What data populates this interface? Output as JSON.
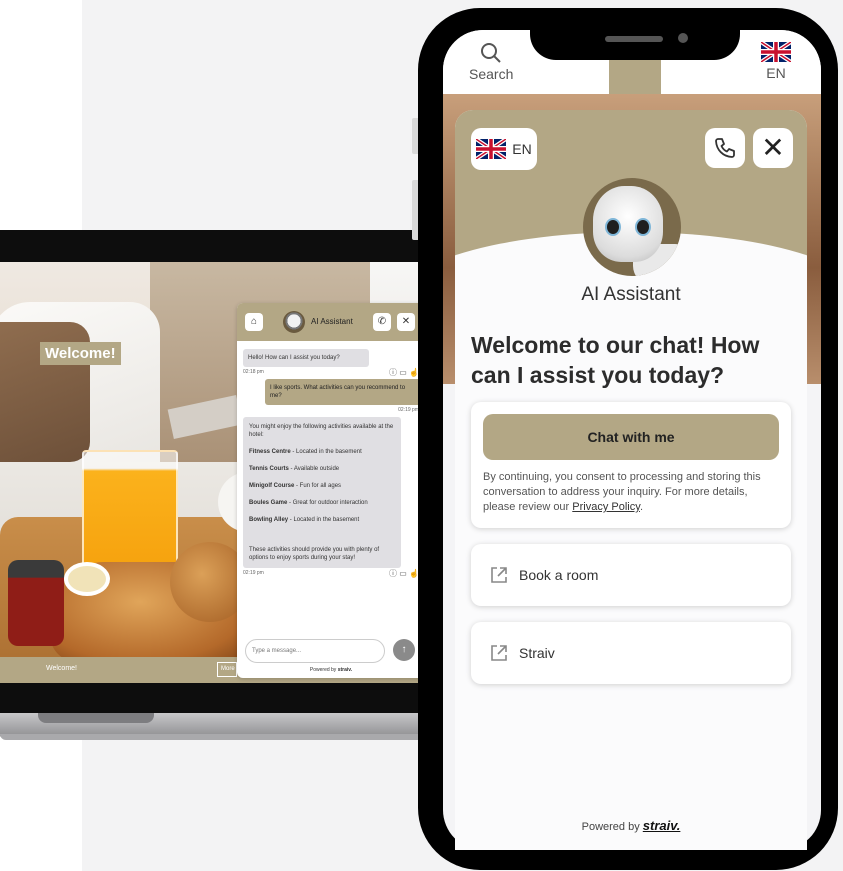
{
  "laptop": {
    "welcome_badge": "Welcome!",
    "footer_text": "Welcome!",
    "footer_button": "More",
    "chat": {
      "title": "AI Assistant",
      "messages": [
        {
          "from": "bot",
          "text": "Hello! How can I assist you today?",
          "time": "02:18 pm"
        },
        {
          "from": "user",
          "text": "I like sports. What activities can you recommend to me?",
          "time": "02:19 pm"
        }
      ],
      "list_intro": "You might enjoy the following activities available at the hotel:",
      "activities": [
        {
          "name": "Fitness Centre",
          "desc": " - Located in the basement"
        },
        {
          "name": "Tennis Courts",
          "desc": " - Available outside"
        },
        {
          "name": "Minigolf Course",
          "desc": " - Fun for all ages"
        },
        {
          "name": "Boules Game",
          "desc": " - Great for outdoor interaction"
        },
        {
          "name": "Bowling Alley",
          "desc": " - Located in the basement"
        }
      ],
      "list_outro": "These activities should provide you with plenty of options to enjoy sports during your stay!",
      "list_time": "02:19 pm",
      "input_placeholder": "Type a message...",
      "powered_by": "Powered by",
      "brand": "straiv."
    }
  },
  "phone": {
    "header": {
      "search_label": "Search",
      "lang_label": "EN"
    },
    "chat": {
      "lang_label": "EN",
      "assistant_name": "AI Assistant",
      "welcome_heading": "Welcome to our chat! How can I assist you today?",
      "chat_button": "Chat with me",
      "consent_text": "By continuing, you consent to processing and storing this conversation to address your inquiry. For more details, please review our ",
      "privacy_link": "Privacy Policy",
      "consent_end": ".",
      "links": [
        {
          "label": "Book a room",
          "icon": "external-link-icon"
        },
        {
          "label": "Straiv",
          "icon": "external-link-icon"
        }
      ],
      "powered_by": "Powered by",
      "brand": "straiv."
    }
  },
  "colors": {
    "accent": "#b3a785",
    "text_dark": "#2c2c2c"
  }
}
